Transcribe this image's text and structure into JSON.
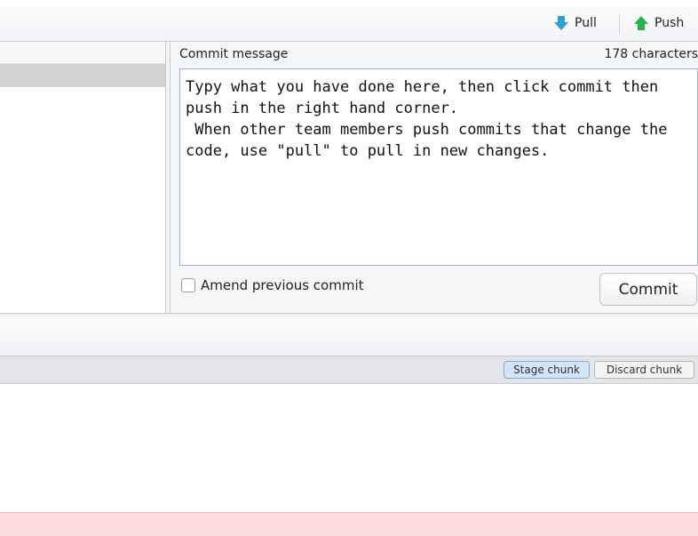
{
  "toolbar": {
    "pull_label": "Pull",
    "push_label": "Push"
  },
  "commit": {
    "label": "Commit message",
    "char_count": "178 characters",
    "message": "Typy what you have done here, then click commit then push in the right hand corner.\n When other team members push commits that change the code, use \"pull\" to pull in new changes.",
    "amend_label": "Amend previous commit",
    "amend_checked": false,
    "commit_button": "Commit"
  },
  "chunk": {
    "stage_label": "Stage chunk",
    "discard_label": "Discard chunk"
  },
  "colors": {
    "pull_arrow": "#2b9fd6",
    "push_arrow": "#25b24a",
    "removed_line_bg": "#fcdcdc",
    "stage_button_bg": "#d4e5f7"
  }
}
